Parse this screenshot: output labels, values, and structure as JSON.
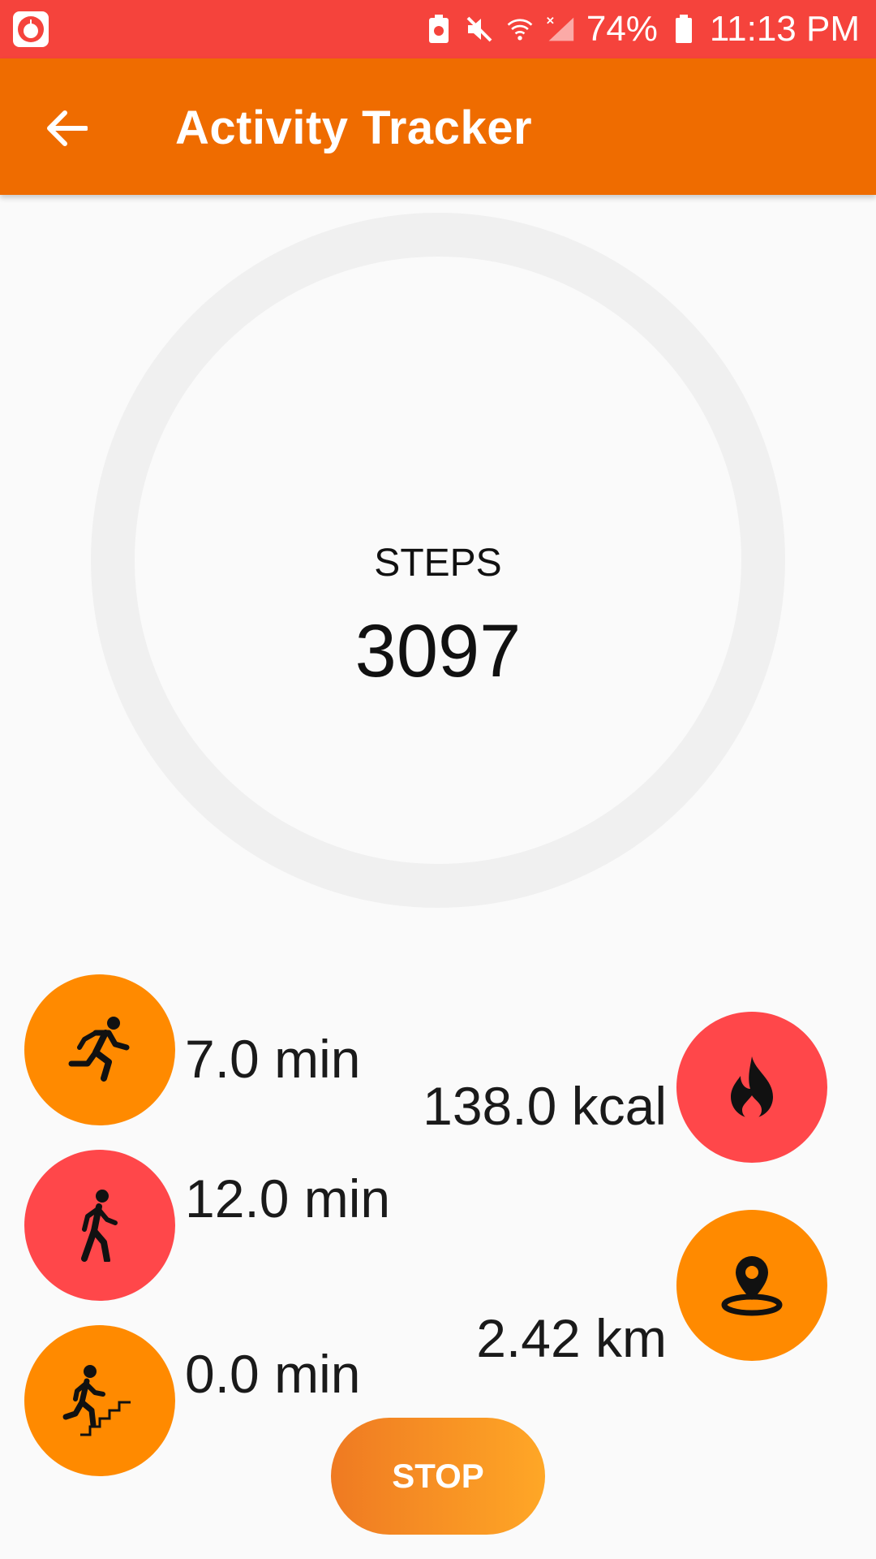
{
  "status_bar": {
    "battery_percent": "74%",
    "time": "11:13 PM",
    "icons": [
      "app-logo-icon",
      "battery-saver-icon",
      "mute-icon",
      "wifi-icon",
      "no-signal-icon",
      "battery-icon"
    ]
  },
  "app_bar": {
    "title": "Activity Tracker",
    "back_icon": "arrow-left-icon"
  },
  "steps": {
    "label": "STEPS",
    "value": "3097"
  },
  "stats": {
    "running": {
      "value": "7.0 min",
      "icon": "running-icon"
    },
    "walking": {
      "value": "12.0 min",
      "icon": "walking-icon"
    },
    "stairs": {
      "value": "0.0 min",
      "icon": "stairs-icon"
    },
    "calories": {
      "value": "138.0 kcal",
      "icon": "flame-icon"
    },
    "distance": {
      "value": "2.42 km",
      "icon": "location-pin-icon"
    }
  },
  "actions": {
    "stop_label": "STOP"
  },
  "colors": {
    "status_bar": "#f5433c",
    "app_bar": "#ef6c00",
    "orange": "#ff8a00",
    "red": "#ff474a",
    "ring": "#f0f0f0"
  }
}
